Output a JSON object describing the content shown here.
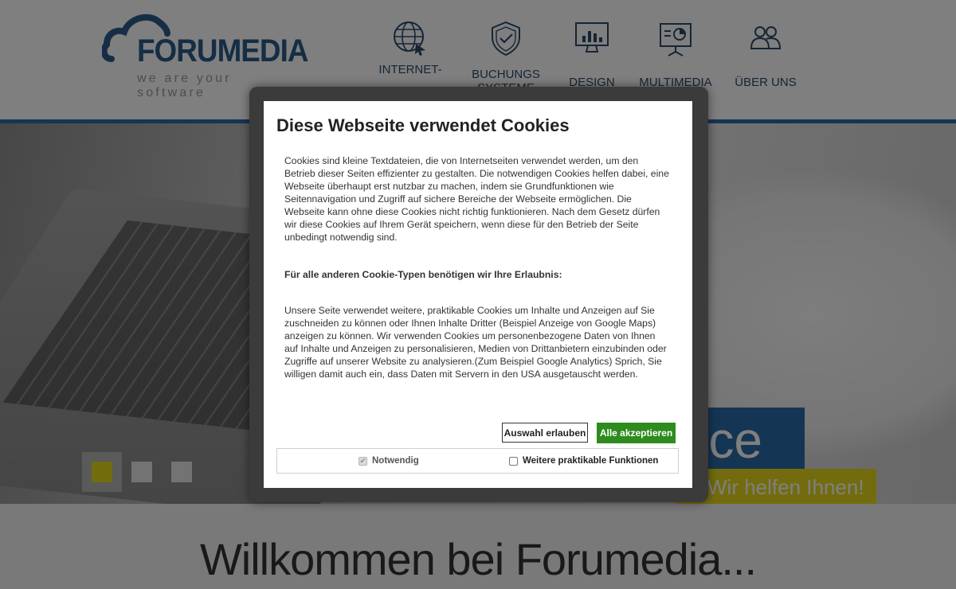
{
  "header": {
    "logo_text": "FORUMEDIA",
    "logo_tagline": "we are your software",
    "nav": [
      {
        "label": "INTERNET-SOFTWARE",
        "icon": "globe-cursor-icon"
      },
      {
        "label": "BUCHUNGS SYSTEME",
        "icon": "shield-check-icon"
      },
      {
        "label": "DESIGN",
        "icon": "monitor-chart-icon"
      },
      {
        "label": "MULTIMEDIA",
        "icon": "presentation-board-icon"
      },
      {
        "label": "ÜBER UNS",
        "icon": "team-people-icon"
      }
    ]
  },
  "hero": {
    "blue_box_text": "rce",
    "yellow_box_text": "Wir helfen Ihnen!",
    "slides": [
      {
        "active": true
      },
      {
        "active": false
      },
      {
        "active": false
      }
    ]
  },
  "welcome_heading": "Willkommen bei Forumedia...",
  "cookie_modal": {
    "title": "Diese Webseite verwendet Cookies",
    "paragraph_1": "Cookies sind kleine Textdateien, die von Internetseiten verwendet werden, um den Betrieb dieser Seiten effizienter zu gestalten. Die notwendigen Cookies helfen dabei, eine Webseite überhaupt erst nutzbar zu machen, indem sie Grundfunktionen wie Seitennavigation und Zugriff auf sichere Bereiche der Webseite ermöglichen. Die Webseite kann ohne diese Cookies nicht richtig funktionieren. Nach dem Gesetz dürfen wir diese Cookies auf Ihrem Gerät speichern, wenn diese für den Betrieb der Seite unbedingt notwendig sind.",
    "paragraph_2": "Für alle anderen Cookie-Typen benötigen wir Ihre Erlaubnis:",
    "paragraph_3": "Unsere Seite verwendet weitere, praktikable Cookies um Inhalte und Anzeigen auf Sie zuschneiden zu können oder Ihnen Inhalte Dritter (Beispiel Anzeige von Google Maps) anzeigen zu können. Wir verwenden Cookies um personenbezogene Daten von Ihnen auf Inhalte und Anzeigen zu personalisieren, Medien von Drittanbietern einzubinden oder Zugriffe auf unserer Website zu analysieren.(Zum Beispiel Google Analytics) Sprich, Sie willigen damit auch ein, dass Daten mit Servern in den USA ausgetauscht werden.",
    "btn_allow_selection": "Auswahl erlauben",
    "btn_accept_all": "Alle akzeptieren",
    "accept_color": "#2e8b1e",
    "checkboxes": [
      {
        "label": "Notwendig",
        "checked": true,
        "disabled": true
      },
      {
        "label": "Weitere praktikable Funktionen",
        "checked": false,
        "disabled": false
      }
    ]
  },
  "colors": {
    "brand_blue": "#2b6aa8",
    "brand_yellow": "#e6d91e",
    "logo_blue": "#2b5c8a"
  }
}
